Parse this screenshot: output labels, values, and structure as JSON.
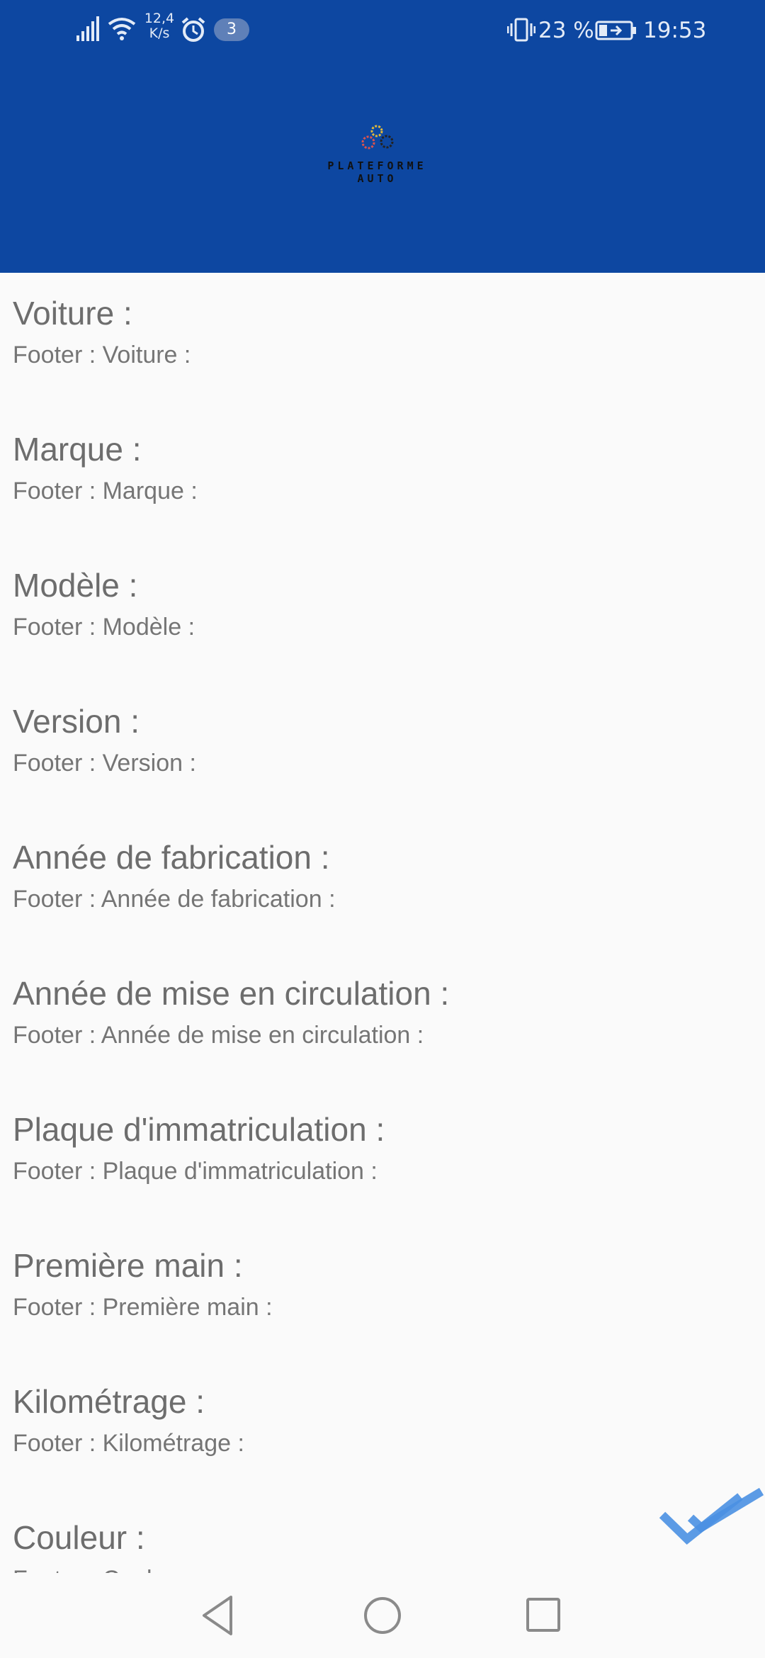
{
  "status_bar": {
    "network_speed_value": "12,4",
    "network_speed_unit": "K/s",
    "notification_count": "3",
    "battery_percent": "23 %",
    "time": "19:53"
  },
  "header": {
    "logo_line1": "PLATEFORME",
    "logo_line2": "AUTO",
    "background_color": "#0d47a1"
  },
  "fields": [
    {
      "label": "Voiture :",
      "footer": "Footer : Voiture :"
    },
    {
      "label": "Marque :",
      "footer": "Footer : Marque :"
    },
    {
      "label": "Modèle :",
      "footer": "Footer : Modèle :"
    },
    {
      "label": "Version :",
      "footer": "Footer : Version :"
    },
    {
      "label": "Année de fabrication :",
      "footer": "Footer : Année de fabrication :"
    },
    {
      "label": "Année de mise en circulation :",
      "footer": "Footer : Année de mise en circulation :"
    },
    {
      "label": "Plaque d'immatriculation :",
      "footer": "Footer : Plaque d'immatriculation :"
    },
    {
      "label": "Première main :",
      "footer": "Footer : Première main :"
    },
    {
      "label": "Kilométrage :",
      "footer": "Footer : Kilométrage :"
    },
    {
      "label": "Couleur :",
      "footer": "Footer : Couleur :"
    }
  ],
  "actions": {
    "confirm_icon": "double-check-icon",
    "accent_color": "#4a90e2"
  },
  "navbar": {
    "back_icon": "back-triangle-icon",
    "home_icon": "home-circle-icon",
    "recents_icon": "recents-square-icon"
  }
}
